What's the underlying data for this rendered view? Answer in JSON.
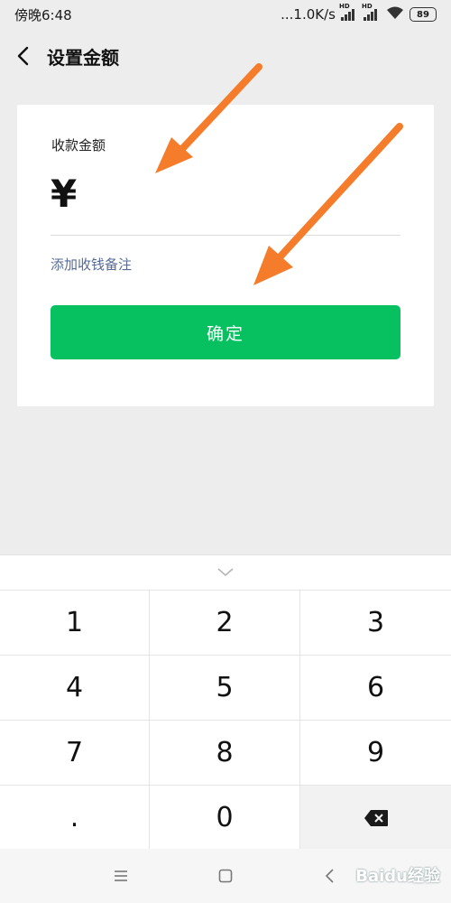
{
  "status_bar": {
    "time": "傍晚6:48",
    "network_speed": "...1.0K/s",
    "hd_label": "HD",
    "battery": "89"
  },
  "header": {
    "title": "设置金额"
  },
  "card": {
    "amount_label": "收款金额",
    "currency_symbol": "¥",
    "amount_value": "",
    "remark_link": "添加收钱备注",
    "confirm_label": "确定"
  },
  "keyboard": {
    "keys": [
      "1",
      "2",
      "3",
      "4",
      "5",
      "6",
      "7",
      "8",
      "9",
      ".",
      "0"
    ]
  },
  "watermark": "Baidu经验",
  "colors": {
    "primary": "#07c160",
    "link": "#576b95",
    "background": "#ededed",
    "annotation_arrow": "#f57c2a"
  }
}
